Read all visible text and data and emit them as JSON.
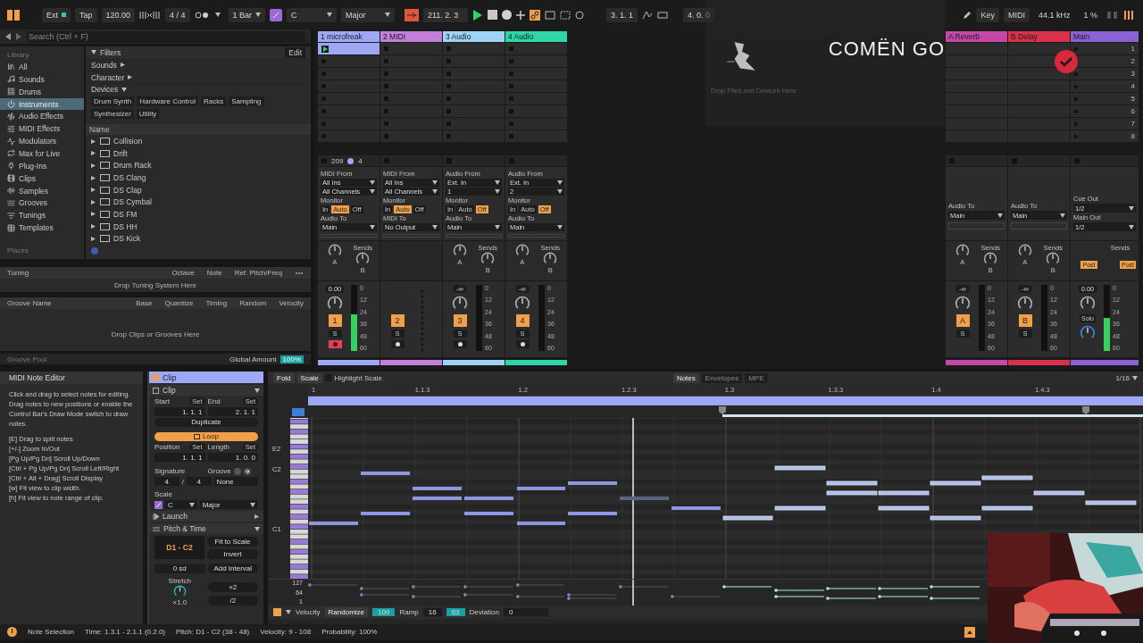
{
  "top_bar": {
    "sync": "Ext",
    "tap": "Tap",
    "tempo": "120.00",
    "signature": "4 / 4",
    "quantize": "1 Bar",
    "key": "C",
    "scale": "Major",
    "position": "211. 2. 3",
    "loop_start": "3. 1. 1",
    "loop_length": "4. 0. 0",
    "key_map": "Key",
    "midi_map": "MIDI",
    "sample_rate": "44.1 kHz",
    "cpu": "1 %"
  },
  "overlay": {
    "title": "COMËN GO"
  },
  "browser": {
    "search_placeholder": "Search (Ctrl + F)",
    "library_label": "Library",
    "library": [
      {
        "label": "All",
        "selected": false
      },
      {
        "label": "Sounds",
        "selected": false
      },
      {
        "label": "Drums",
        "selected": false
      },
      {
        "label": "Instruments",
        "selected": true
      },
      {
        "label": "Audio Effects",
        "selected": false
      },
      {
        "label": "MIDI Effects",
        "selected": false
      },
      {
        "label": "Modulators",
        "selected": false
      },
      {
        "label": "Max for Live",
        "selected": false
      },
      {
        "label": "Plug-Ins",
        "selected": false
      },
      {
        "label": "Clips",
        "selected": false
      },
      {
        "label": "Samples",
        "selected": false
      },
      {
        "label": "Grooves",
        "selected": false
      },
      {
        "label": "Tunings",
        "selected": false
      },
      {
        "label": "Templates",
        "selected": false
      }
    ],
    "places_label": "Places",
    "filters": {
      "title": "Filters",
      "edit": "Edit",
      "groups": [
        {
          "label": "Sounds",
          "expanded": false
        },
        {
          "label": "Character",
          "expanded": false
        },
        {
          "label": "Devices",
          "expanded": true
        }
      ],
      "tags": [
        "Drum Synth",
        "Hardware Control",
        "Racks",
        "Sampling",
        "Synthesizer",
        "Utility"
      ]
    },
    "name_header": "Name",
    "items": [
      "Collision",
      "Drift",
      "Drum Rack",
      "DS Clang",
      "DS Clap",
      "DS Cymbal",
      "DS FM",
      "DS HH",
      "DS Kick"
    ]
  },
  "tuning": {
    "columns": [
      "Tuning",
      "Octave",
      "Note",
      "Ref. Pitch/Freq"
    ],
    "hint": "Drop Tuning System Here"
  },
  "groove": {
    "columns": [
      "Groove Name",
      "Base",
      "Quantize",
      "Timing",
      "Random",
      "Velocity"
    ],
    "hint": "Drop Clips or Grooves Here",
    "footer": "Groove Pool",
    "amount_label": "Global Amount",
    "amount": "100%"
  },
  "session": {
    "drop_hint": "Drop Files and Devices Here"
  },
  "strips": [
    {
      "kind": "midi",
      "name": "1 microfreak",
      "color": "#9ea8f5",
      "first_clip": true,
      "stop_info": [
        "209",
        "4"
      ],
      "io": {
        "from_label": "MIDI From",
        "from": "All Ins",
        "channel": "All Channels",
        "monitor_label": "Monitor",
        "monitor": [
          {
            "label": "In",
            "selected": false
          },
          {
            "label": "Auto",
            "selected": true
          },
          {
            "label": "Off",
            "selected": false
          }
        ],
        "to_label": "Audio To",
        "to": "Main"
      },
      "sends": {
        "label": "Sends",
        "knobs": [
          "A",
          "B"
        ]
      },
      "mixer": {
        "volume": "0.00",
        "number": "1",
        "solo": "S",
        "armed": true,
        "level": 0.55,
        "scale": [
          "0",
          "12",
          "24",
          "36",
          "48",
          "60"
        ]
      }
    },
    {
      "kind": "midi",
      "name": "2 MIDI",
      "color": "#c27ed8",
      "io": {
        "from_label": "MIDI From",
        "from": "All Ins",
        "channel": "All Channels",
        "monitor_label": "Monitor",
        "monitor": [
          {
            "label": "In",
            "selected": false
          },
          {
            "label": "Auto",
            "selected": true
          },
          {
            "label": "Off",
            "selected": false
          }
        ],
        "to_label": "MIDI To",
        "to": "No Output"
      },
      "mixer": {
        "number": "2",
        "solo": "S",
        "armed": false
      }
    },
    {
      "kind": "audio",
      "name": "3 Audio",
      "color": "#9fd3f5",
      "io": {
        "from_label": "Audio From",
        "from": "Ext. In",
        "channel": "1",
        "monitor_label": "Monitor",
        "monitor": [
          {
            "label": "In",
            "selected": false
          },
          {
            "label": "Auto",
            "selected": false
          },
          {
            "label": "Off",
            "selected": true
          }
        ],
        "to_label": "Audio To",
        "to": "Main"
      },
      "sends": {
        "label": "Sends",
        "knobs": [
          "A",
          "B"
        ]
      },
      "mixer": {
        "volume": "-∞",
        "number": "3",
        "solo": "S",
        "armed": false,
        "level": 0,
        "scale": [
          "0",
          "12",
          "24",
          "36",
          "48",
          "60"
        ]
      }
    },
    {
      "kind": "audio",
      "name": "4 Audio",
      "color": "#2fd6a8",
      "io": {
        "from_label": "Audio From",
        "from": "Ext. In",
        "channel": "2",
        "monitor_label": "Monitor",
        "monitor": [
          {
            "label": "In",
            "selected": false
          },
          {
            "label": "Auto",
            "selected": false
          },
          {
            "label": "Off",
            "selected": true
          }
        ],
        "to_label": "Audio To",
        "to": "Main"
      },
      "sends": {
        "label": "Sends",
        "knobs": [
          "A",
          "B"
        ]
      },
      "mixer": {
        "volume": "-∞",
        "number": "4",
        "solo": "S",
        "armed": false,
        "level": 0,
        "scale": [
          "0",
          "12",
          "24",
          "36",
          "48",
          "60"
        ]
      }
    },
    {
      "kind": "return",
      "name": "A Reverb",
      "color": "#c548a8",
      "io": {
        "to_label": "Audio To",
        "to": "Main"
      },
      "sends": {
        "label": "Sends",
        "knobs": [
          "A",
          "B"
        ]
      },
      "mixer": {
        "volume": "-∞",
        "number": "A",
        "solo": "S",
        "level": 0,
        "scale": [
          "0",
          "12",
          "24",
          "36",
          "48",
          "60"
        ]
      }
    },
    {
      "kind": "return",
      "name": "B Delay",
      "color": "#d8324a",
      "io": {
        "to_label": "Audio To",
        "to": "Main"
      },
      "sends": {
        "label": "Sends",
        "knobs": [
          "A",
          "B"
        ]
      },
      "mixer": {
        "volume": "-∞",
        "number": "B",
        "solo": "S",
        "level": 0,
        "scale": [
          "0",
          "12",
          "24",
          "36",
          "48",
          "60"
        ]
      }
    },
    {
      "kind": "main",
      "name": "Main",
      "color": "#8a62d6",
      "scenes": [
        "1",
        "2",
        "3",
        "4",
        "5",
        "6",
        "7",
        "8"
      ],
      "io": {
        "cue_label": "Cue Out",
        "cue": "1/2",
        "main_label": "Main Out",
        "main": "1/2"
      },
      "sends": {
        "label": "Sends",
        "post": [
          "Post",
          "Post"
        ]
      },
      "mixer": {
        "volume": "0.00",
        "solo": "Solo",
        "level": 0.5,
        "scale": [
          "0",
          "12",
          "24",
          "36",
          "48",
          "60"
        ]
      }
    }
  ],
  "info": {
    "title": "MIDI Note Editor",
    "paragraphs": [
      "Click and drag to select notes for editing. Drag notes to new positions or enable the Control Bar's Draw Mode switch to draw notes.",
      "[E] Drag to split notes",
      "[+/-] Zoom In/Out",
      "[Pg Up/Pg Dn] Scroll Up/Down",
      "[Ctrl + Pg Up/Pg Dn] Scroll Left/Right",
      "[Ctrl + Alt + Drag] Scroll Display",
      "[w] Fit view to clip width.",
      "[h] Fit view to note range of clip."
    ]
  },
  "clip": {
    "header": "Clip",
    "section": "Clip",
    "start_label": "Start",
    "start_set": "Set",
    "end_label": "End",
    "end_set": "Set",
    "start": "1. 1. 1",
    "end": "2. 1. 1",
    "duplicate": "Duplicate",
    "loop": {
      "label": "Loop",
      "on": true
    },
    "position_label": "Position",
    "position_set": "Set",
    "length_label": "Length",
    "length_set": "Set",
    "position": "1. 1. 1",
    "length": "1. 0. 0",
    "signature_label": "Signature",
    "groove_label": "Groove",
    "sig_num": "4",
    "sig_sep": "/",
    "sig_den": "4",
    "groove": "None",
    "scale_label": "Scale",
    "scale_root": "C",
    "scale_name": "Major",
    "launch": "Launch",
    "pitch_time": "Pitch & Time",
    "range": "D1 - C2",
    "fit": "Fit to Scale",
    "invert": "Invert",
    "transpose": "0 sd",
    "add_interval": "Add Interval",
    "stretch_label": "Stretch",
    "double": "×2",
    "half": "/2",
    "stretch": "×1.0"
  },
  "piano_roll": {
    "fold": "Fold",
    "scale": "Scale",
    "highlight": "Highlight Scale",
    "tabs": [
      {
        "label": "Notes",
        "selected": true
      },
      {
        "label": "Envelopes",
        "selected": false
      },
      {
        "label": "MPE",
        "selected": false
      }
    ],
    "grid": "1/16",
    "ruler": [
      "1",
      "1.1.3",
      "1.2",
      "1.2.3",
      "1.3",
      "1.3.3",
      "1.4",
      "1.4.3"
    ],
    "key_labels": [
      "E2",
      "C2",
      "C1"
    ],
    "velocity_ticks": [
      "127",
      "64",
      "1"
    ],
    "velocity_bar": {
      "label": "Velocity",
      "randomize": "Randomize",
      "randomize_value": "100",
      "ramp": "Ramp",
      "ramp_start": "16",
      "ramp_end": "63",
      "deviation": "Deviation",
      "deviation_value": "0"
    }
  },
  "status_bar": [
    "Note Selection",
    "Time: 1.3.1 - 2.1.1 (0.2.0)",
    "Pitch: D1 - C2 (38 - 48)",
    "Velocity: 9 - 108",
    "Probability: 100%"
  ]
}
